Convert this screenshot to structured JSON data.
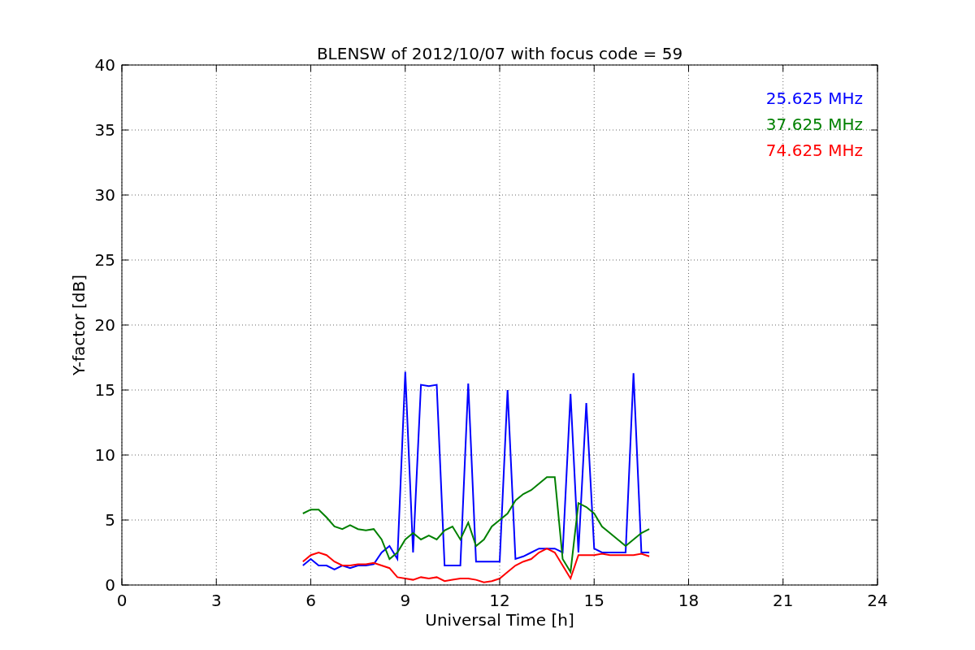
{
  "figure": {
    "chart_data": {
      "type": "line",
      "title": "BLENSW of 2012/10/07 with focus code = 59",
      "xlabel": "Universal Time [h]",
      "ylabel": "Y-factor [dB]",
      "x": [
        5.75,
        6,
        6.25,
        6.5,
        6.75,
        7,
        7.25,
        7.5,
        7.75,
        8,
        8.25,
        8.5,
        8.75,
        9,
        9.25,
        9.5,
        9.75,
        10,
        10.25,
        10.5,
        10.75,
        11,
        11.25,
        11.5,
        11.75,
        12,
        12.25,
        12.5,
        12.75,
        13,
        13.25,
        13.5,
        13.75,
        14,
        14.25,
        14.5,
        14.75,
        15,
        15.25,
        15.5,
        15.75,
        16,
        16.25,
        16.5,
        16.75
      ],
      "series": [
        {
          "name": "25.625 MHz",
          "color": "#0000ff",
          "values": [
            1.5,
            2,
            1.5,
            1.5,
            1.2,
            1.5,
            1.3,
            1.5,
            1.5,
            1.6,
            2.5,
            3,
            2,
            16.4,
            2.5,
            15.4,
            15.3,
            15.4,
            1.5,
            1.5,
            1.5,
            15.5,
            1.8,
            1.8,
            1.8,
            1.8,
            15,
            2,
            2.2,
            2.5,
            2.8,
            2.8,
            2.8,
            2.5,
            14.7,
            2.5,
            14,
            2.8,
            2.5,
            2.5,
            2.5,
            2.5,
            16.3,
            2.5,
            2.5
          ]
        },
        {
          "name": "37.625 MHz",
          "color": "#008000",
          "values": [
            5.5,
            5.8,
            5.8,
            5.2,
            4.5,
            4.3,
            4.6,
            4.3,
            4.2,
            4.3,
            3.5,
            2,
            2.5,
            3.5,
            4,
            3.5,
            3.8,
            3.5,
            4.2,
            4.5,
            3.5,
            4.8,
            3,
            3.5,
            4.5,
            5,
            5.5,
            6.5,
            7,
            7.3,
            7.8,
            8.3,
            8.3,
            2,
            1,
            6.3,
            6,
            5.5,
            4.5,
            4,
            3.5,
            3,
            3.5,
            4,
            4.3
          ]
        },
        {
          "name": "74.625 MHz",
          "color": "#ff0000",
          "values": [
            1.8,
            2.3,
            2.5,
            2.3,
            1.8,
            1.5,
            1.5,
            1.6,
            1.6,
            1.7,
            1.5,
            1.3,
            0.6,
            0.5,
            0.4,
            0.6,
            0.5,
            0.6,
            0.3,
            0.4,
            0.5,
            0.5,
            0.4,
            0.2,
            0.3,
            0.5,
            1,
            1.5,
            1.8,
            2,
            2.5,
            2.8,
            2.5,
            1.5,
            0.5,
            2.3,
            2.3,
            2.3,
            2.4,
            2.3,
            2.3,
            2.3,
            2.3,
            2.4,
            2.2
          ]
        }
      ],
      "grid": true,
      "xlim": [
        0,
        24
      ],
      "ylim": [
        0,
        40
      ],
      "xticks": [
        0,
        3,
        6,
        9,
        12,
        15,
        18,
        21,
        24
      ],
      "yticks": [
        0,
        5,
        10,
        15,
        20,
        25,
        30,
        35,
        40
      ]
    }
  }
}
